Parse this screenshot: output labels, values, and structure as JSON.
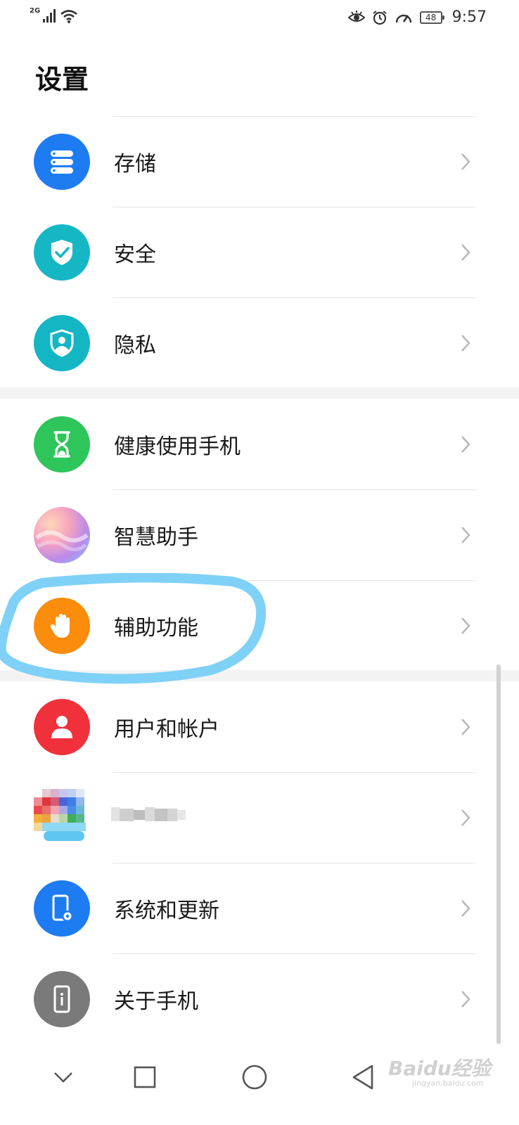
{
  "status_bar": {
    "network": "2G",
    "battery": "48",
    "time": "9:57"
  },
  "page_title": "设置",
  "items": [
    {
      "label": "存储",
      "icon": "storage-icon",
      "color": "#1e7cf2"
    },
    {
      "label": "安全",
      "icon": "shield-check-icon",
      "color": "#16b7c5"
    },
    {
      "label": "隐私",
      "icon": "privacy-icon",
      "color": "#14b6c4"
    },
    {
      "label": "健康使用手机",
      "icon": "hourglass-icon",
      "color": "#2ec55a"
    },
    {
      "label": "智慧助手",
      "icon": "assistant-icon",
      "color": "#c89ae8"
    },
    {
      "label": "辅助功能",
      "icon": "hand-icon",
      "color": "#fb8c0c"
    },
    {
      "label": "用户和帐户",
      "icon": "user-icon",
      "color": "#f0313c"
    },
    {
      "label": "",
      "icon": "blurred-app-icon",
      "color": "#cccccc"
    },
    {
      "label": "系统和更新",
      "icon": "phone-settings-icon",
      "color": "#1e7cf2"
    },
    {
      "label": "关于手机",
      "icon": "phone-info-icon",
      "color": "#7a7a7a"
    }
  ],
  "highlight_color": "#7fd1f7",
  "watermark": {
    "brand": "Baidu经验",
    "url": "jingyan.baidu.com"
  }
}
